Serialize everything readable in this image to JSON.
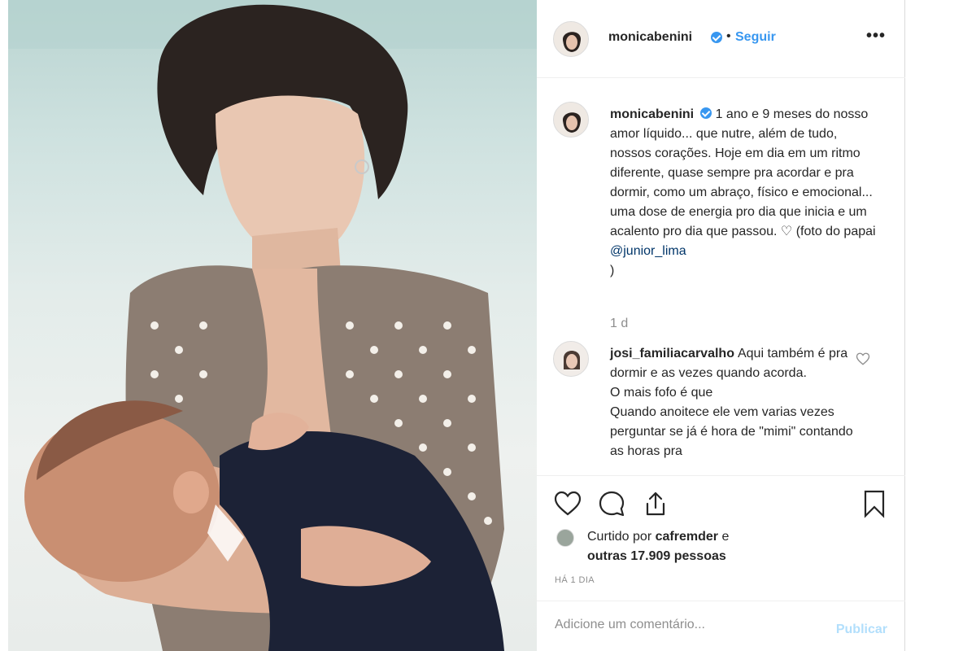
{
  "post": {
    "username": "monicabenini",
    "separator": "•",
    "follow_label": "Seguir",
    "more_label": "•••",
    "caption": {
      "username": "monicabenini",
      "text": "1 ano e 9 meses do nosso amor líquido... que nutre, além de tudo, nossos corações. Hoje em dia em um ritmo diferente, quase sempre pra acordar e pra dormir, como um abraço, físico e emocional... uma dose de energia pro dia que inicia e um acalento pro dia que passou. ♡ (foto do papai",
      "mention": "@junior_lima",
      "tail": ")"
    },
    "time_ago": "1 d",
    "comments": [
      {
        "username": "josi_familiacarvalho",
        "text_lines": [
          "Aqui também é pra dormir e as vezes quando acorda.",
          "O mais fofo é que",
          "Quando anoitece ele vem varias vezes perguntar se já é hora de \"mimi\" contando as horas pra"
        ]
      }
    ],
    "likes": {
      "prefix": "Curtido por",
      "liker": "cafremder",
      "middle": "e",
      "others": "outras 17.909 pessoas"
    },
    "posted": "HÁ 1 DIA",
    "add_comment_placeholder": "Adicione um comentário...",
    "publish_label": "Publicar"
  },
  "colors": {
    "accent": "#3897f0",
    "text": "#262626",
    "muted": "#8e8e8e",
    "publish_disabled": "#b2dffc",
    "mention": "#003569"
  }
}
